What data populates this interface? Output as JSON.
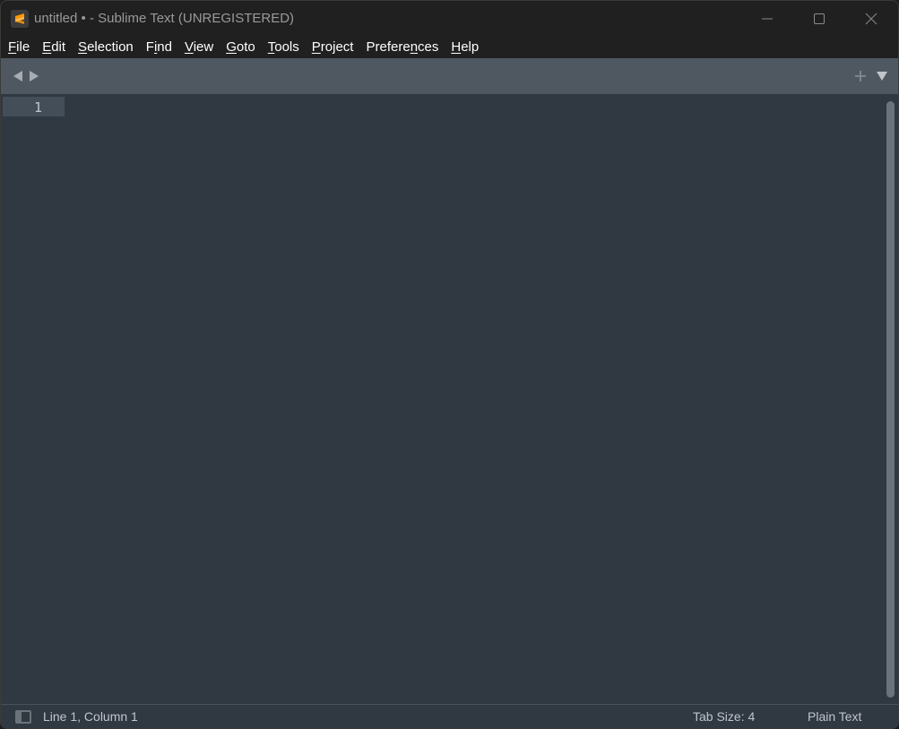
{
  "window": {
    "title": "untitled • - Sublime Text (UNREGISTERED)",
    "icon": "sublime-text-logo-icon",
    "controls": {
      "minimize": "minimize-icon",
      "maximize": "maximize-icon",
      "close": "close-icon"
    }
  },
  "menubar": {
    "items": [
      {
        "label": "File",
        "mnemonic": "F",
        "rest": "ile"
      },
      {
        "label": "Edit",
        "mnemonic": "E",
        "rest": "dit"
      },
      {
        "label": "Selection",
        "mnemonic": "S",
        "rest": "election"
      },
      {
        "label": "Find",
        "pre": "F",
        "mnemonic": "i",
        "rest": "nd"
      },
      {
        "label": "View",
        "mnemonic": "V",
        "rest": "iew"
      },
      {
        "label": "Goto",
        "mnemonic": "G",
        "rest": "oto"
      },
      {
        "label": "Tools",
        "mnemonic": "T",
        "rest": "ools"
      },
      {
        "label": "Project",
        "mnemonic": "P",
        "rest": "roject"
      },
      {
        "label": "Preferences",
        "pre": "Prefere",
        "mnemonic": "n",
        "rest": "ces"
      },
      {
        "label": "Help",
        "mnemonic": "H",
        "rest": "elp"
      }
    ]
  },
  "tabbar": {
    "prev_icon": "triangle-left-icon",
    "next_icon": "triangle-right-icon",
    "new_tab_icon": "plus-icon",
    "tab_menu_icon": "triangle-down-icon"
  },
  "editor": {
    "lines": [
      {
        "number": "1",
        "text": ""
      }
    ],
    "current_line": 1
  },
  "statusbar": {
    "sidebar_toggle_icon": "sidebar-toggle-icon",
    "position": "Line 1, Column 1",
    "tab_size": "Tab Size: 4",
    "syntax": "Plain Text"
  },
  "colors": {
    "titlebar_bg": "#202020",
    "tabbar_bg": "#4f5861",
    "editor_bg": "#303841",
    "gutter_highlight": "#444e58",
    "accent_logo": "#ff9800"
  }
}
